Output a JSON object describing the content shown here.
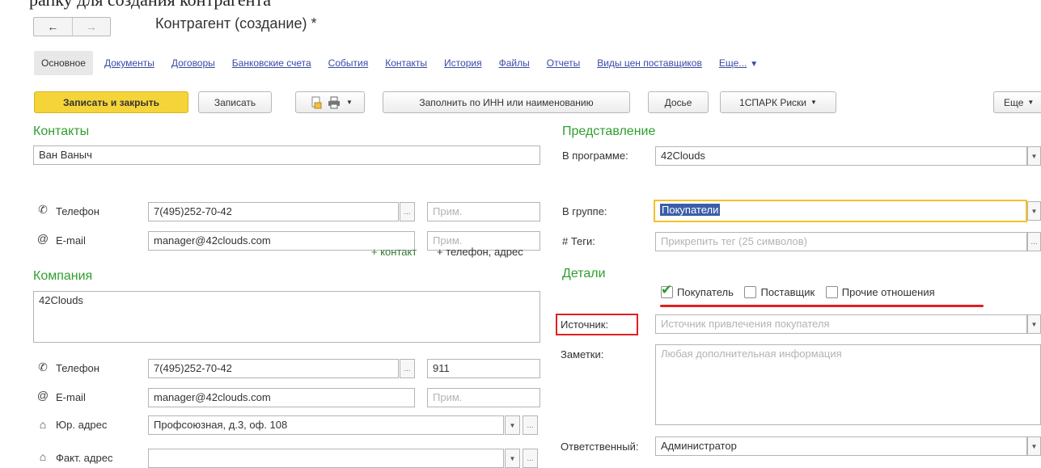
{
  "colors": {
    "section_title": "#2f9f2f",
    "link": "#3a4aa3",
    "primary_button": "#f5d43a",
    "highlight_border": "#f3c22a",
    "annotation_red": "#e02020"
  },
  "window": {
    "title": "Контрагент (создание) *",
    "nav_back": "←",
    "nav_forward": "→"
  },
  "tabs": [
    {
      "label": "Основное",
      "active": true
    },
    {
      "label": "Документы"
    },
    {
      "label": "Договоры"
    },
    {
      "label": "Банковские счета"
    },
    {
      "label": "События"
    },
    {
      "label": "Контакты"
    },
    {
      "label": "История"
    },
    {
      "label": "Файлы"
    },
    {
      "label": "Отчеты"
    },
    {
      "label": "Виды цен поставщиков"
    },
    {
      "label": "Еще..."
    }
  ],
  "toolbar": {
    "save_close": "Записать и закрыть",
    "save": "Записать",
    "fill_by_inn": "Заполнить по ИНН или наименованию",
    "dossier": "Досье",
    "spark": "1СПАРК Риски",
    "more": "Еще"
  },
  "contacts": {
    "title": "Контакты",
    "name": "Ван Ваныч",
    "phone_label": "Телефон",
    "phone_value": "7(495)252-70-42",
    "phone_note_placeholder": "Прим.",
    "email_label": "E-mail",
    "email_value": "manager@42clouds.com",
    "email_note_placeholder": "Прим.",
    "add_contact": "+ контакт",
    "add_phone_address": "+ телефон, адрес"
  },
  "company": {
    "title": "Компания",
    "name": "42Clouds",
    "phone_label": "Телефон",
    "phone_value": "7(495)252-70-42",
    "phone_ext": "911",
    "email_label": "E-mail",
    "email_value": "manager@42clouds.com",
    "email_note_placeholder": "Прим.",
    "legal_address_label": "Юр. адрес",
    "legal_address_value": "Профсоюзная,  д.3, оф. 108",
    "actual_address_label": "Факт. адрес",
    "actual_address_value": ""
  },
  "representation": {
    "title": "Представление",
    "in_program_label": "В программе:",
    "in_program_value": "42Clouds",
    "group_label": "В группе:",
    "group_value": "Покупатели",
    "tags_label": "# Теги:",
    "tags_placeholder": "Прикрепить тег (25 символов)"
  },
  "details": {
    "title": "Детали",
    "buyer": "Покупатель",
    "buyer_checked": true,
    "supplier": "Поставщик",
    "supplier_checked": false,
    "other": "Прочие отношения",
    "other_checked": false,
    "source_label": "Источник:",
    "source_placeholder": "Источник привлечения покупателя",
    "notes_label": "Заметки:",
    "notes_placeholder": "Любая дополнительная информация",
    "responsible_label": "Ответственный:",
    "responsible_value": "Администратор"
  }
}
